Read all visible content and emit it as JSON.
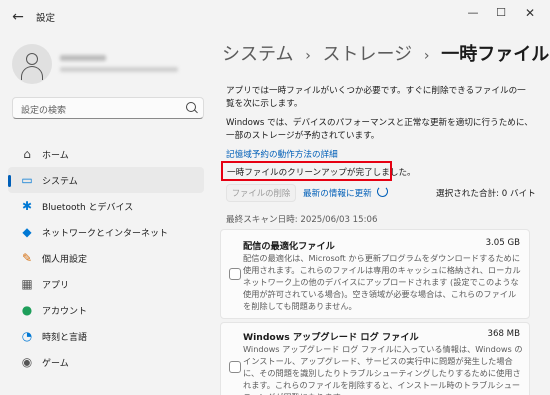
{
  "window": {
    "title": "設定",
    "back_icon": "←",
    "minimize_icon": "—",
    "maximize_icon": "☐",
    "close_icon": "✕"
  },
  "sidebar": {
    "search_placeholder": "設定の検索",
    "items": [
      {
        "label": "ホーム",
        "icon": "home-icon",
        "glyph": "⌂",
        "color": "#444444"
      },
      {
        "label": "システム",
        "icon": "system-icon",
        "glyph": "▭",
        "color": "#0078d4",
        "active": true
      },
      {
        "label": "Bluetooth とデバイス",
        "icon": "bluetooth-icon",
        "glyph": "✱",
        "color": "#0078d4"
      },
      {
        "label": "ネットワークとインターネット",
        "icon": "network-icon",
        "glyph": "◆",
        "color": "#0078d4"
      },
      {
        "label": "個人用設定",
        "icon": "personalization-icon",
        "glyph": "✎",
        "color": "#d46b08"
      },
      {
        "label": "アプリ",
        "icon": "apps-icon",
        "glyph": "▦",
        "color": "#555555"
      },
      {
        "label": "アカウント",
        "icon": "accounts-icon",
        "glyph": "●",
        "color": "#1e9e5a"
      },
      {
        "label": "時刻と言語",
        "icon": "time-language-icon",
        "glyph": "◔",
        "color": "#0078d4"
      },
      {
        "label": "ゲーム",
        "icon": "gaming-icon",
        "glyph": "◉",
        "color": "#555555"
      }
    ]
  },
  "breadcrumb": {
    "items": [
      "システム",
      "ストレージ"
    ],
    "current": "一時ファイル",
    "separator": "›"
  },
  "main": {
    "intro": "アプリでは一時ファイルがいくつか必要です。すぐに削除できるファイルの一覧を次に示します。",
    "reserved": "Windows では、デバイスのパフォーマンスと正常な更新を適切に行うために、一部のストレージが予約されています。",
    "reserved_link": "記憶域予約の動作方法の詳細",
    "notice": "一時ファイルのクリーンアップが完了しました。",
    "cleanup_button": "ファイルの削除",
    "refresh_link": "最新の情報に更新",
    "total_selected": "選択された合計: 0 バイト",
    "last_scan": "最終スキャン日時: 2025/06/03 15:06",
    "items": [
      {
        "title": "配信の最適化ファイル",
        "size": "3.05 GB",
        "desc": "配信の最適化は、Microsoft から更新プログラムをダウンロードするために使用されます。これらのファイルは専用のキャッシュに格納され、ローカル ネットワーク上の他のデバイスにアップロードされます (設定でこのような使用が許可されている場合)。空き領域が必要な場合は、これらのファイルを削除しても問題ありません。"
      },
      {
        "title": "Windows アップグレード ログ ファイル",
        "size": "368 MB",
        "desc": "Windows アップグレード ログ ファイルに入っている情報は、Windows のインストール、アップグレード、サービスの実行中に問題が発生した場合に、その問題を識別したりトラブルシューティングしたりするために使用されます。これらのファイルを削除すると、インストール時のトラブルシューティングが困難になります。"
      }
    ]
  }
}
